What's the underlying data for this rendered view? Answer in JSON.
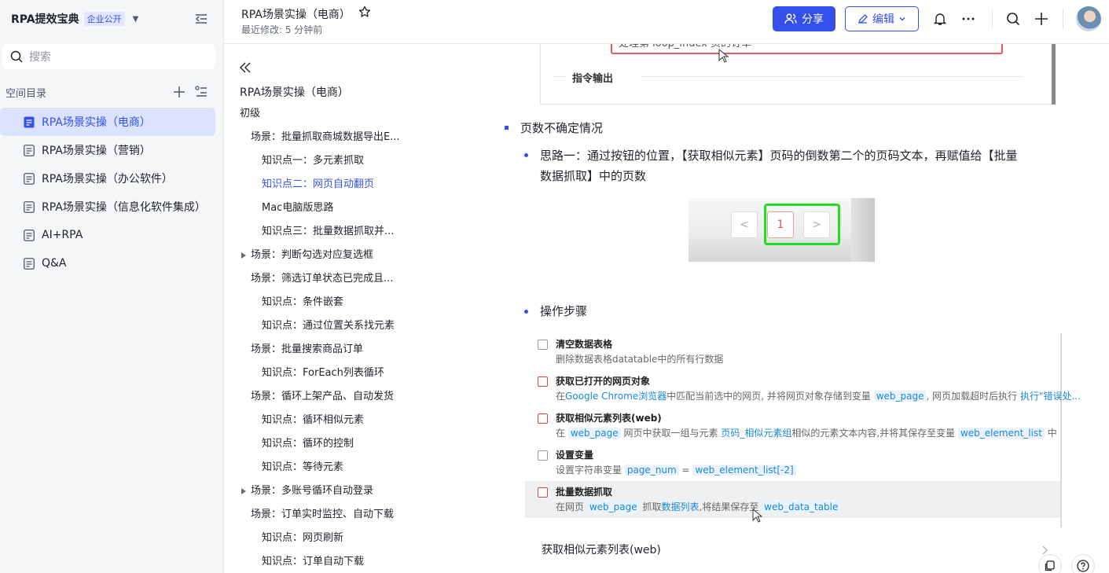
{
  "sidebar": {
    "brand": "RPA提效宝典",
    "badge": "企业公开",
    "search_placeholder": "搜索",
    "space_title": "空间目录",
    "items": [
      {
        "label": "RPA场景实操（电商）",
        "active": true
      },
      {
        "label": "RPA场景实操（营销）"
      },
      {
        "label": "RPA场景实操（办公软件）"
      },
      {
        "label": "RPA场景实操（信息化软件集成）"
      },
      {
        "label": "AI+RPA"
      },
      {
        "label": "Q&A"
      }
    ]
  },
  "header": {
    "title": "RPA场景实操（电商）",
    "modified": "最近修改: 5 分钟前",
    "share_label": "分享",
    "edit_label": "编辑"
  },
  "toc": {
    "title": "RPA场景实操（电商）",
    "items": [
      {
        "label": "初级",
        "level": 0
      },
      {
        "label": "场景：批量抓取商城数据导出E...",
        "level": 1
      },
      {
        "label": "知识点一：多元素抓取",
        "level": 2
      },
      {
        "label": "知识点二：网页自动翻页",
        "level": 2,
        "active": true
      },
      {
        "label": "Mac电脑版思路",
        "level": 2
      },
      {
        "label": "知识点三：批量数据抓取并...",
        "level": 2
      },
      {
        "label": "场景：判断勾选对应复选框",
        "level": 1,
        "collapsed": true
      },
      {
        "label": "场景：筛选订单状态已完成且...",
        "level": 1
      },
      {
        "label": "知识点：条件嵌套",
        "level": 2
      },
      {
        "label": "知识点：通过位置关系找元素",
        "level": 2
      },
      {
        "label": "场景：批量搜索商品订单",
        "level": 1
      },
      {
        "label": "知识点：ForEach列表循环",
        "level": 2
      },
      {
        "label": "场景：循环上架产品、自动发货",
        "level": 1
      },
      {
        "label": "知识点：循环相似元素",
        "level": 2
      },
      {
        "label": "知识点：循环的控制",
        "level": 2
      },
      {
        "label": "知识点：等待元素",
        "level": 2
      },
      {
        "label": "场景：多账号循环自动登录",
        "level": 1,
        "collapsed": true
      },
      {
        "label": "场景：订单实时监控、自动下载",
        "level": 1
      },
      {
        "label": "知识点：网页刷新",
        "level": 2
      },
      {
        "label": "知识点：订单自动下载",
        "level": 2
      }
    ]
  },
  "content": {
    "top_input_text": "处理第 loop_index 页的订单",
    "top_output_label": "指令输出",
    "heading1": "页数不确定情况",
    "idea_line1": "思路一：通过按钮的位置，【获取相似元素】页码的倒数第二个的页码文本，再赋值给【批量",
    "idea_line2": "数据抓取】中的页数",
    "pager": {
      "prev": "<",
      "current": "1",
      "next": ">"
    },
    "steps_heading": "操作步骤",
    "steps": [
      {
        "title": "清空数据表格",
        "desc": "删除数据表格datatable中的所有行数据"
      },
      {
        "title": "获取已打开的网页对象",
        "desc_pre": "在",
        "desc_link": "Google Chrome浏览器",
        "desc_mid": "中匹配当前选中的网页, 并将网页对象存储到变量",
        "desc_chip": "web_page",
        "desc_post": ", 网页加载超时后执行",
        "desc_link2": "执行\"错误处..."
      },
      {
        "title": "获取相似元素列表(web)",
        "desc_pre": "在",
        "desc_chip": "web_page",
        "desc_mid": "网页中获取一组与元素",
        "desc_link": "页码_相似元素组",
        "desc_mid2": "相似的元素文本内容,并将其保存至变量",
        "desc_chip2": "web_element_list",
        "desc_post": "中"
      },
      {
        "title": "设置变量",
        "desc_pre": "设置字符串变量",
        "desc_chip": "page_num",
        "desc_mid": "=",
        "desc_chip2": "web_element_list[-2]"
      },
      {
        "title": "批量数据抓取",
        "desc_pre": "在网页",
        "desc_chip": "web_page",
        "desc_mid": "抓取",
        "desc_link": "数据列表",
        "desc_mid2": ",将结果保存至",
        "desc_chip2": "web_data_table"
      }
    ],
    "bottom_label": "获取相似元素列表(web)"
  }
}
